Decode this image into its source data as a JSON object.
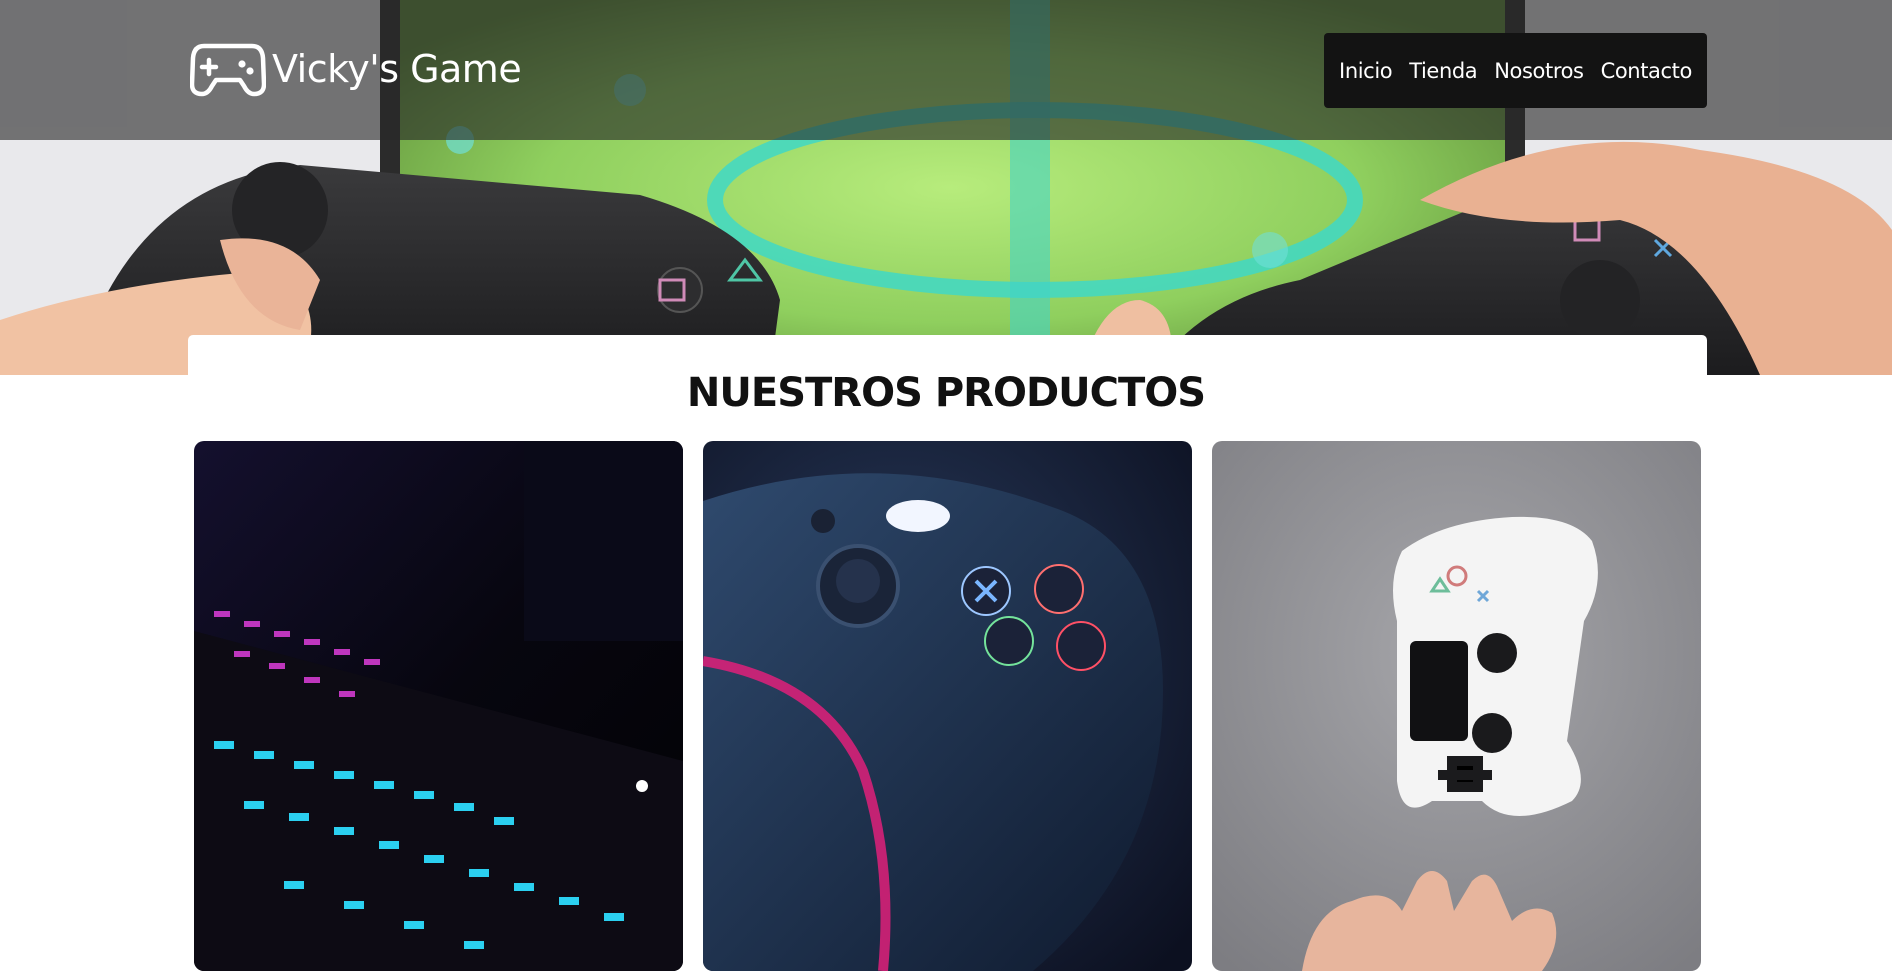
{
  "header": {
    "logo_text": "Vicky's Game",
    "logo_icon": "gamepad-icon",
    "nav": [
      {
        "label": "Inicio"
      },
      {
        "label": "Tienda"
      },
      {
        "label": "Nosotros"
      },
      {
        "label": "Contacto"
      }
    ]
  },
  "hero": {
    "image": "hands-holding-controllers-photo"
  },
  "products": {
    "title": "NUESTROS PRODUCTOS",
    "items": [
      {
        "image": "rgb-keyboard-photo"
      },
      {
        "image": "xbox-controller-photo"
      },
      {
        "image": "ps4-controller-photo"
      }
    ]
  },
  "colors": {
    "header_overlay": "#3a3a3a",
    "nav_bg": "#131313",
    "title": "#111111"
  }
}
